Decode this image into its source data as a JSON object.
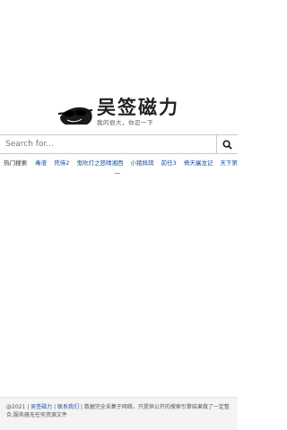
{
  "logo": {
    "title": "吴签磁力",
    "slogan": "我的很大，你忍一下",
    "icon": "avatar-sunglasses-icon"
  },
  "search": {
    "placeholder": "Search for...",
    "value": "",
    "button_icon": "search-icon"
  },
  "hot": {
    "label": "热门搜索",
    "items": [
      "毒液",
      "死侍2",
      "鬼吹灯之怒晴湘西",
      "小猪佩琪",
      "前任3",
      "倚天屠龙记",
      "天下第一"
    ]
  },
  "footer": {
    "year": "@2021",
    "site_link": "吴签磁力",
    "sep": "|",
    "contact_link": "联系我们",
    "disclaimer": "| 数据完全采集于网络，只提供公开的搜索引擎结果做了一定整合,服务器无任何资源文件"
  },
  "colors": {
    "link": "#1a4fa0",
    "footer_bg": "#f4f4f4"
  }
}
